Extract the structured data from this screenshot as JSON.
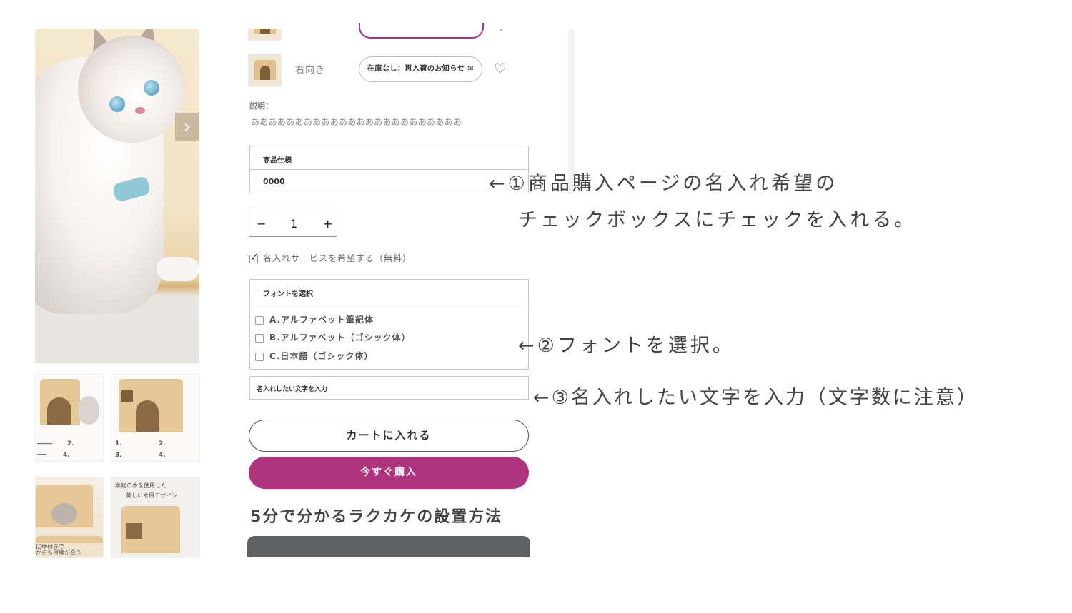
{
  "gallery": {
    "next_arrow": "›",
    "thumb3_text": [
      "本物の木を使用した",
      "美しい木目デザイン"
    ],
    "thumb2_text": [
      "に壁付きで",
      "からも目線が合う"
    ],
    "thumb_numbers": [
      "2.",
      "4.",
      "1.",
      "3.",
      "2.",
      "4."
    ]
  },
  "variants": {
    "row_right": {
      "label": "右向き",
      "notify_button": "在庫なし：再入荷のお知らせ ✉",
      "heart": "♡"
    },
    "chevron": "⌄"
  },
  "description": {
    "label": "説明：",
    "text": "ああああああああああああああああああああああああ"
  },
  "spec": {
    "header": "商品仕様",
    "value": "0000"
  },
  "quantity": {
    "minus": "−",
    "value": "1",
    "plus": "+"
  },
  "engraving": {
    "checkbox_label": "名入れサービスを希望する（無料）",
    "checked": true
  },
  "font_select": {
    "header": "フォントを選択",
    "options": [
      "A.アルファベット筆記体",
      "B.アルファベット（ゴシック体）",
      "C.日本語（ゴシック体）"
    ]
  },
  "text_input": {
    "placeholder": "名入れしたい文字を入力"
  },
  "buttons": {
    "cart": "カートに入れる",
    "buy_now": "今すぐ購入"
  },
  "section": {
    "title": "5分で分かるラクカケの設置方法"
  },
  "annotations": {
    "step1_line1": "←①商品購入ページの名入れ希望の",
    "step1_line2": "チェックボックスにチェックを入れる。",
    "step2": "←②フォントを選択。",
    "step3": "←③名入れしたい文字を入力（文字数に注意）"
  },
  "colors": {
    "accent": "#b0337f",
    "video_bar": "#5f6062"
  }
}
